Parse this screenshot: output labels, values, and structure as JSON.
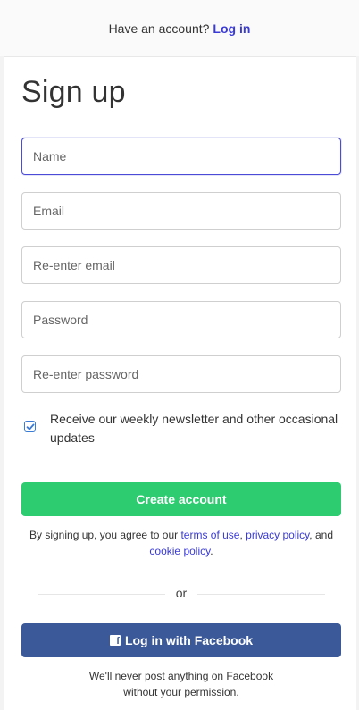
{
  "header": {
    "prompt_text": "Have an account?",
    "login_link": "Log in"
  },
  "page_title": "Sign up",
  "form": {
    "name_placeholder": "Name",
    "email_placeholder": "Email",
    "reenter_email_placeholder": "Re-enter email",
    "password_placeholder": "Password",
    "reenter_password_placeholder": "Re-enter password",
    "newsletter_label": "Receive our weekly newsletter and other occasional updates",
    "newsletter_checked": true,
    "create_button": "Create account"
  },
  "terms": {
    "prefix": "By signing up, you agree to our ",
    "terms_link": "terms of use",
    "comma": ", ",
    "privacy_link": "privacy policy",
    "and": ", and ",
    "cookie_link": "cookie policy",
    "suffix": "."
  },
  "divider_text": "or",
  "facebook": {
    "button_label": "Log in with Facebook",
    "note_line1": "We'll never post anything on Facebook",
    "note_line2": "without your permission."
  },
  "colors": {
    "accent": "#3a3ad6",
    "create_button": "#2ecc71",
    "facebook_button": "#3b5998"
  }
}
